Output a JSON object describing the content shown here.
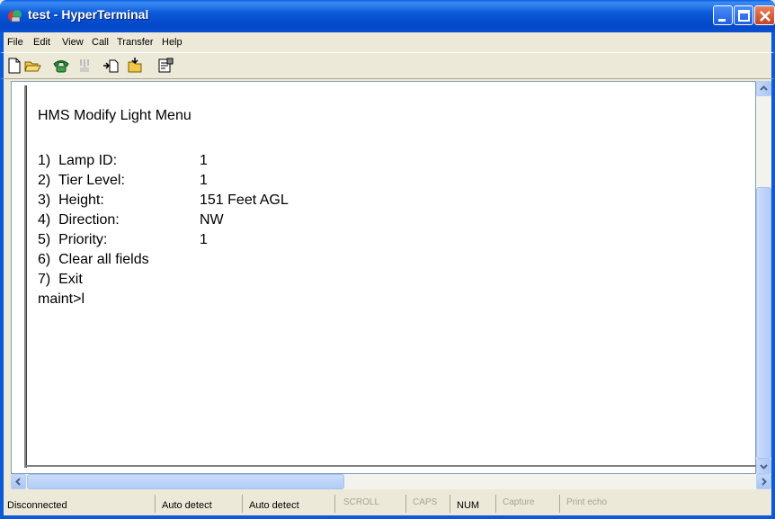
{
  "window": {
    "title": "test - HyperTerminal"
  },
  "menu": [
    "File",
    "Edit",
    "View",
    "Call",
    "Transfer",
    "Help"
  ],
  "toolbar": [
    "new-icon",
    "open-icon",
    "dial-icon",
    "disconnect-icon",
    "send-icon",
    "receive-icon",
    "properties-icon"
  ],
  "terminal": {
    "heading": "HMS Modify Light Menu",
    "items": [
      {
        "label": "1)  Lamp ID:",
        "value": "1"
      },
      {
        "label": "2)  Tier Level:",
        "value": "1"
      },
      {
        "label": "3)  Height:",
        "value": "151 Feet AGL"
      },
      {
        "label": "4)  Direction:",
        "value": "NW"
      },
      {
        "label": "5)  Priority:",
        "value": "1"
      },
      {
        "label": "6)  Clear all fields",
        "value": ""
      },
      {
        "label": "7)  Exit",
        "value": ""
      }
    ],
    "prompt": "maint>l"
  },
  "status": {
    "connection": "Disconnected",
    "detect1": "Auto detect",
    "detect2": "Auto detect",
    "scroll": "SCROLL",
    "caps": "CAPS",
    "num": "NUM",
    "capture": "Capture",
    "print_echo": "Print echo"
  },
  "colors": {
    "titlebar": "#0b5ad8",
    "close_button": "#c64421"
  }
}
